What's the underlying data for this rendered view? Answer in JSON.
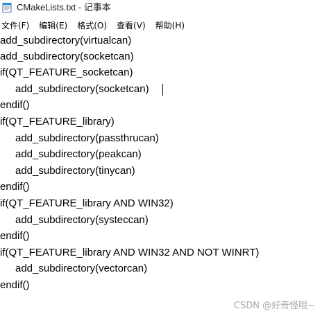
{
  "window": {
    "title": "CMakeLists.txt - 记事本",
    "icon": "notepad-icon"
  },
  "menu": {
    "items": [
      {
        "label": "文件(F)"
      },
      {
        "label": "编辑(E)"
      },
      {
        "label": "格式(O)"
      },
      {
        "label": "查看(V)"
      },
      {
        "label": "帮助(H)"
      }
    ]
  },
  "editor": {
    "lines": [
      "add_subdirectory(virtualcan)",
      "add_subdirectory(socketcan)",
      "if(QT_FEATURE_socketcan)",
      "add_subdirectory(socketcan)",
      "endif()",
      "if(QT_FEATURE_library)",
      "add_subdirectory(passthrucan)",
      "add_subdirectory(peakcan)",
      "add_subdirectory(tinycan)",
      "endif()",
      "if(QT_FEATURE_library AND WIN32)",
      "add_subdirectory(systeccan)",
      "endif()",
      "if(QT_FEATURE_library AND WIN32 AND NOT WINRT)",
      "add_subdirectory(vectorcan)",
      "endif()"
    ]
  },
  "watermark": {
    "text": "CSDN @好奇怪哦~"
  }
}
